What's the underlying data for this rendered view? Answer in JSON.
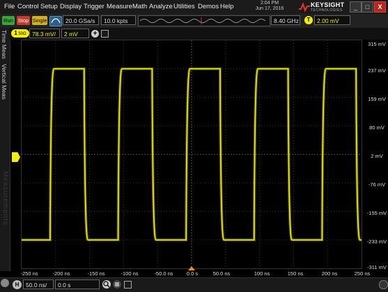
{
  "menu": [
    "File",
    "Control",
    "Setup",
    "Display",
    "Trigger",
    "Measure",
    "Math",
    "Analyze",
    "Utilities",
    "Demos",
    "Help"
  ],
  "clock": {
    "time": "2:04 PM",
    "date": "Jun 17, 2016"
  },
  "brand": {
    "name": "KEYSIGHT",
    "sub": "TECHNOLOGIES"
  },
  "window_controls": [
    "_",
    "□",
    "X"
  ],
  "toolbar": {
    "run": "Run",
    "stop": "Stop",
    "single": "Single",
    "sample_rate": "20.0 GSa/s",
    "memory_depth": "10.0 kpts",
    "bandwidth": "8.40 GHz",
    "trigger_badge": "T",
    "trigger_level": "2.00 mV"
  },
  "channel": {
    "badge": "1",
    "impedance": "50Ω",
    "scale": "78.3 mV/",
    "offset": "2 mV",
    "add": "+"
  },
  "side_tabs": {
    "time_meas": "Time Meas",
    "vertical_meas": "Vertical Meas",
    "measurements": "Measurements"
  },
  "y_axis_labels": [
    "315 mV",
    "237 mV",
    "159 mV",
    "80 mV",
    "2 mV",
    "-76 mV",
    "-155 mV",
    "-233 mV",
    "-311 mV"
  ],
  "x_axis_labels": [
    "-250 ns",
    "-200 ns",
    "-150 ns",
    "-100 ns",
    "-50.0 ns",
    "0.0 s",
    "50.0 ns",
    "100 ns",
    "150 ns",
    "200 ns",
    "250 ns"
  ],
  "horizontal": {
    "badge": "H",
    "scale": "50.0 ns/",
    "position": "0.0 s"
  },
  "colors": {
    "trace": "#f2f000",
    "run": "#3aa53a",
    "stop": "#c43b2b",
    "single": "#d4b020",
    "trigger": "#f2f000"
  },
  "waveform": {
    "type": "square",
    "period_ns": 100,
    "high_mv": 237,
    "low_mv": -233,
    "rising_edges_ns": [
      -208,
      -108,
      -8,
      92,
      192
    ]
  }
}
